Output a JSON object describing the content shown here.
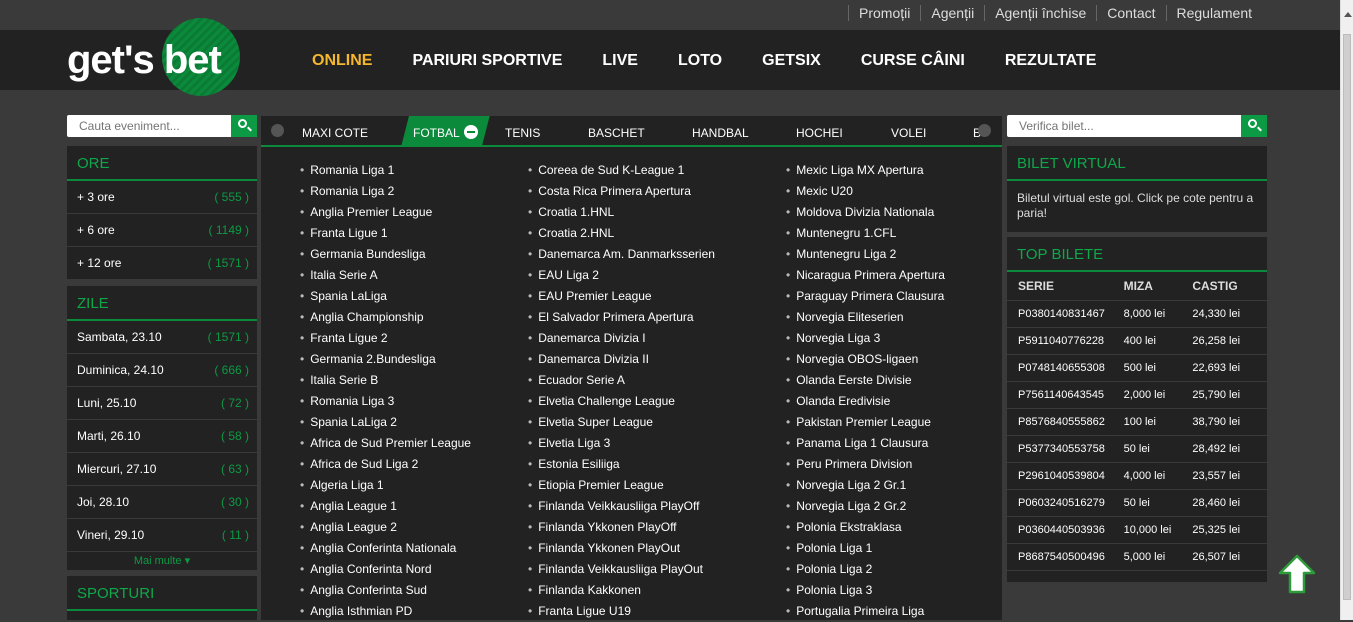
{
  "toplinks": [
    "Promoții",
    "Agenții",
    "Agenții închise",
    "Contact",
    "Regulament"
  ],
  "logo": {
    "text": "get's bet"
  },
  "nav": [
    {
      "label": "ONLINE",
      "active": true
    },
    {
      "label": "PARIURI SPORTIVE"
    },
    {
      "label": "LIVE"
    },
    {
      "label": "LOTO"
    },
    {
      "label": "GETSIX"
    },
    {
      "label": "CURSE CÂINI"
    },
    {
      "label": "REZULTATE"
    }
  ],
  "search_event": {
    "placeholder": "Cauta eveniment..."
  },
  "search_ticket": {
    "placeholder": "Verifica bilet..."
  },
  "ore": {
    "title": "ORE",
    "items": [
      {
        "label": "+ 3 ore",
        "count": "( 555 )"
      },
      {
        "label": "+ 6 ore",
        "count": "( 1149 )"
      },
      {
        "label": "+ 12 ore",
        "count": "( 1571 )"
      }
    ]
  },
  "zile": {
    "title": "ZILE",
    "items": [
      {
        "label": "Sambata, 23.10",
        "count": "( 1571 )"
      },
      {
        "label": "Duminica, 24.10",
        "count": "( 666 )"
      },
      {
        "label": "Luni, 25.10",
        "count": "( 72 )"
      },
      {
        "label": "Marti, 26.10",
        "count": "( 58 )"
      },
      {
        "label": "Miercuri, 27.10",
        "count": "( 63 )"
      },
      {
        "label": "Joi, 28.10",
        "count": "( 30 )"
      },
      {
        "label": "Vineri, 29.10",
        "count": "( 11 )"
      }
    ],
    "more": "Mai multe"
  },
  "sporturi": {
    "title": "SPORTURI"
  },
  "tabs": [
    "MAXI COTE",
    "FOTBAL",
    "TENIS",
    "BASCHET",
    "HANDBAL",
    "HOCHEI",
    "VOLEI",
    "B"
  ],
  "leagues": {
    "col1": [
      "Romania Liga 1",
      "Romania Liga 2",
      "Anglia Premier League",
      "Franta Ligue 1",
      "Germania Bundesliga",
      "Italia Serie A",
      "Spania LaLiga",
      "Anglia Championship",
      "Franta Ligue 2",
      "Germania 2.Bundesliga",
      "Italia Serie B",
      "Romania Liga 3",
      "Spania LaLiga 2",
      "Africa de Sud Premier League",
      "Africa de Sud Liga 2",
      "Algeria Liga 1",
      "Anglia League 1",
      "Anglia League 2",
      "Anglia Conferinta Nationala",
      "Anglia Conferinta Nord",
      "Anglia Conferinta Sud",
      "Anglia Isthmian PD"
    ],
    "col2": [
      "Coreea de Sud K-League 1",
      "Costa Rica Primera Apertura",
      "Croatia 1.HNL",
      "Croatia 2.HNL",
      "Danemarca Am. Danmarksserien",
      "EAU Liga 2",
      "EAU Premier League",
      "El Salvador Primera Apertura",
      "Danemarca Divizia I",
      "Danemarca Divizia II",
      "Ecuador Serie A",
      "Elvetia Challenge League",
      "Elvetia Super League",
      "Elvetia Liga 3",
      "Estonia Esiliiga",
      "Etiopia Premier League",
      "Finlanda Veikkausliiga PlayOff",
      "Finlanda Ykkonen PlayOff",
      "Finlanda Ykkonen PlayOut",
      "Finlanda Veikkausliiga PlayOut",
      "Finlanda Kakkonen",
      "Franta Ligue U19"
    ],
    "col3": [
      "Mexic Liga MX Apertura",
      "Mexic U20",
      "Moldova Divizia Nationala",
      "Muntenegru 1.CFL",
      "Muntenegru Liga 2",
      "Nicaragua Primera Apertura",
      "Paraguay Primera Clausura",
      "Norvegia Eliteserien",
      "Norvegia Liga 3",
      "Norvegia OBOS-ligaen",
      "Olanda Eerste Divisie",
      "Olanda Eredivisie",
      "Pakistan Premier League",
      "Panama Liga 1 Clausura",
      "Peru Primera Division",
      "Norvegia Liga 2 Gr.1",
      "Norvegia Liga 2 Gr.2",
      "Polonia Ekstraklasa",
      "Polonia Liga 1",
      "Polonia Liga 2",
      "Polonia Liga 3",
      "Portugalia Primeira Liga"
    ]
  },
  "bilet_virtual": {
    "title": "BILET VIRTUAL",
    "text": "Biletul virtual este gol. Click pe cote pentru a paria!"
  },
  "top_bilete": {
    "title": "TOP BILETE",
    "headers": [
      "SERIE",
      "MIZA",
      "CASTIG"
    ],
    "rows": [
      [
        "P0380140831467",
        "8,000 lei",
        "24,330 lei"
      ],
      [
        "P5911040776228",
        "400 lei",
        "26,258 lei"
      ],
      [
        "P0748140655308",
        "500 lei",
        "22,693 lei"
      ],
      [
        "P7561140643545",
        "2,000 lei",
        "25,790 lei"
      ],
      [
        "P8576840555862",
        "100 lei",
        "38,790 lei"
      ],
      [
        "P5377340553758",
        "50 lei",
        "28,492 lei"
      ],
      [
        "P2961040539804",
        "4,000 lei",
        "23,557 lei"
      ],
      [
        "P0603240516279",
        "50 lei",
        "28,460 lei"
      ],
      [
        "P0360440503936",
        "10,000 lei",
        "25,325 lei"
      ],
      [
        "P8687540500496",
        "5,000 lei",
        "26,507 lei"
      ]
    ]
  },
  "colors": {
    "accent": "#0b8a3c",
    "active_nav": "#f5b72e",
    "panel_bg": "#222222",
    "page_bg": "#3a3a3a"
  }
}
